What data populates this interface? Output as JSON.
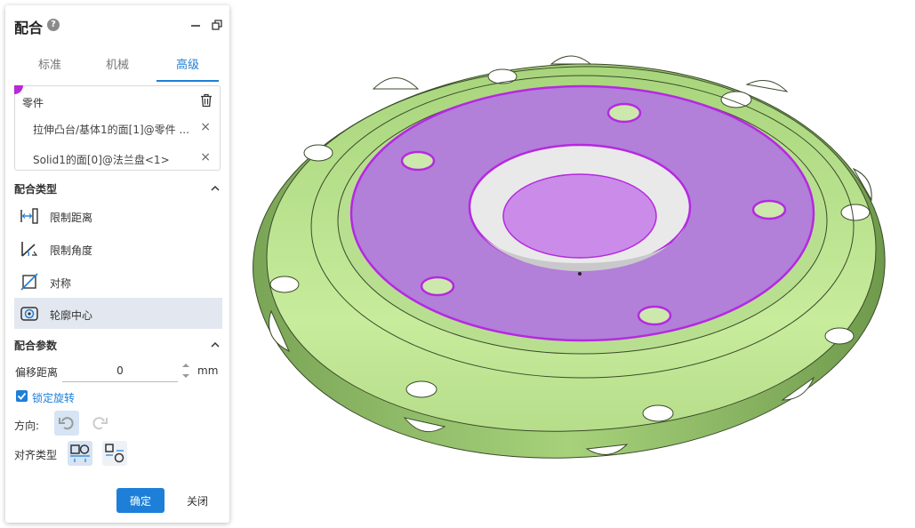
{
  "panel": {
    "title": "配合",
    "help_icon": "help-circle-icon",
    "tabs": [
      {
        "label": "标准",
        "active": false
      },
      {
        "label": "机械",
        "active": false
      },
      {
        "label": "高级",
        "active": true
      }
    ]
  },
  "parts": {
    "label": "零件",
    "items": [
      {
        "text": "拉伸凸台/基体1的面[1]@零件 ...",
        "remove": "×"
      },
      {
        "text": "Solid1的面[0]@法兰盘<1>",
        "remove": "×"
      }
    ]
  },
  "mate_type": {
    "heading": "配合类型",
    "items": [
      {
        "label": "限制距离",
        "icon": "limit-distance-icon",
        "selected": false
      },
      {
        "label": "限制角度",
        "icon": "limit-angle-icon",
        "selected": false
      },
      {
        "label": "对称",
        "icon": "symmetric-icon",
        "selected": false
      },
      {
        "label": "轮廓中心",
        "icon": "profile-center-icon",
        "selected": true
      }
    ]
  },
  "mate_params": {
    "heading": "配合参数",
    "offset_label": "偏移距离",
    "offset_value": "0",
    "offset_unit": "mm",
    "lock_rotation_label": "锁定旋转",
    "lock_rotation_checked": true,
    "direction_label": "方向:",
    "align_label": "对齐类型"
  },
  "footer": {
    "ok_label": "确定",
    "close_label": "关闭"
  },
  "colors": {
    "accent": "#1e7fd8",
    "part_green": "#a8d97a",
    "face_highlight": "#b27fd9",
    "edge_highlight": "#b529e0"
  }
}
